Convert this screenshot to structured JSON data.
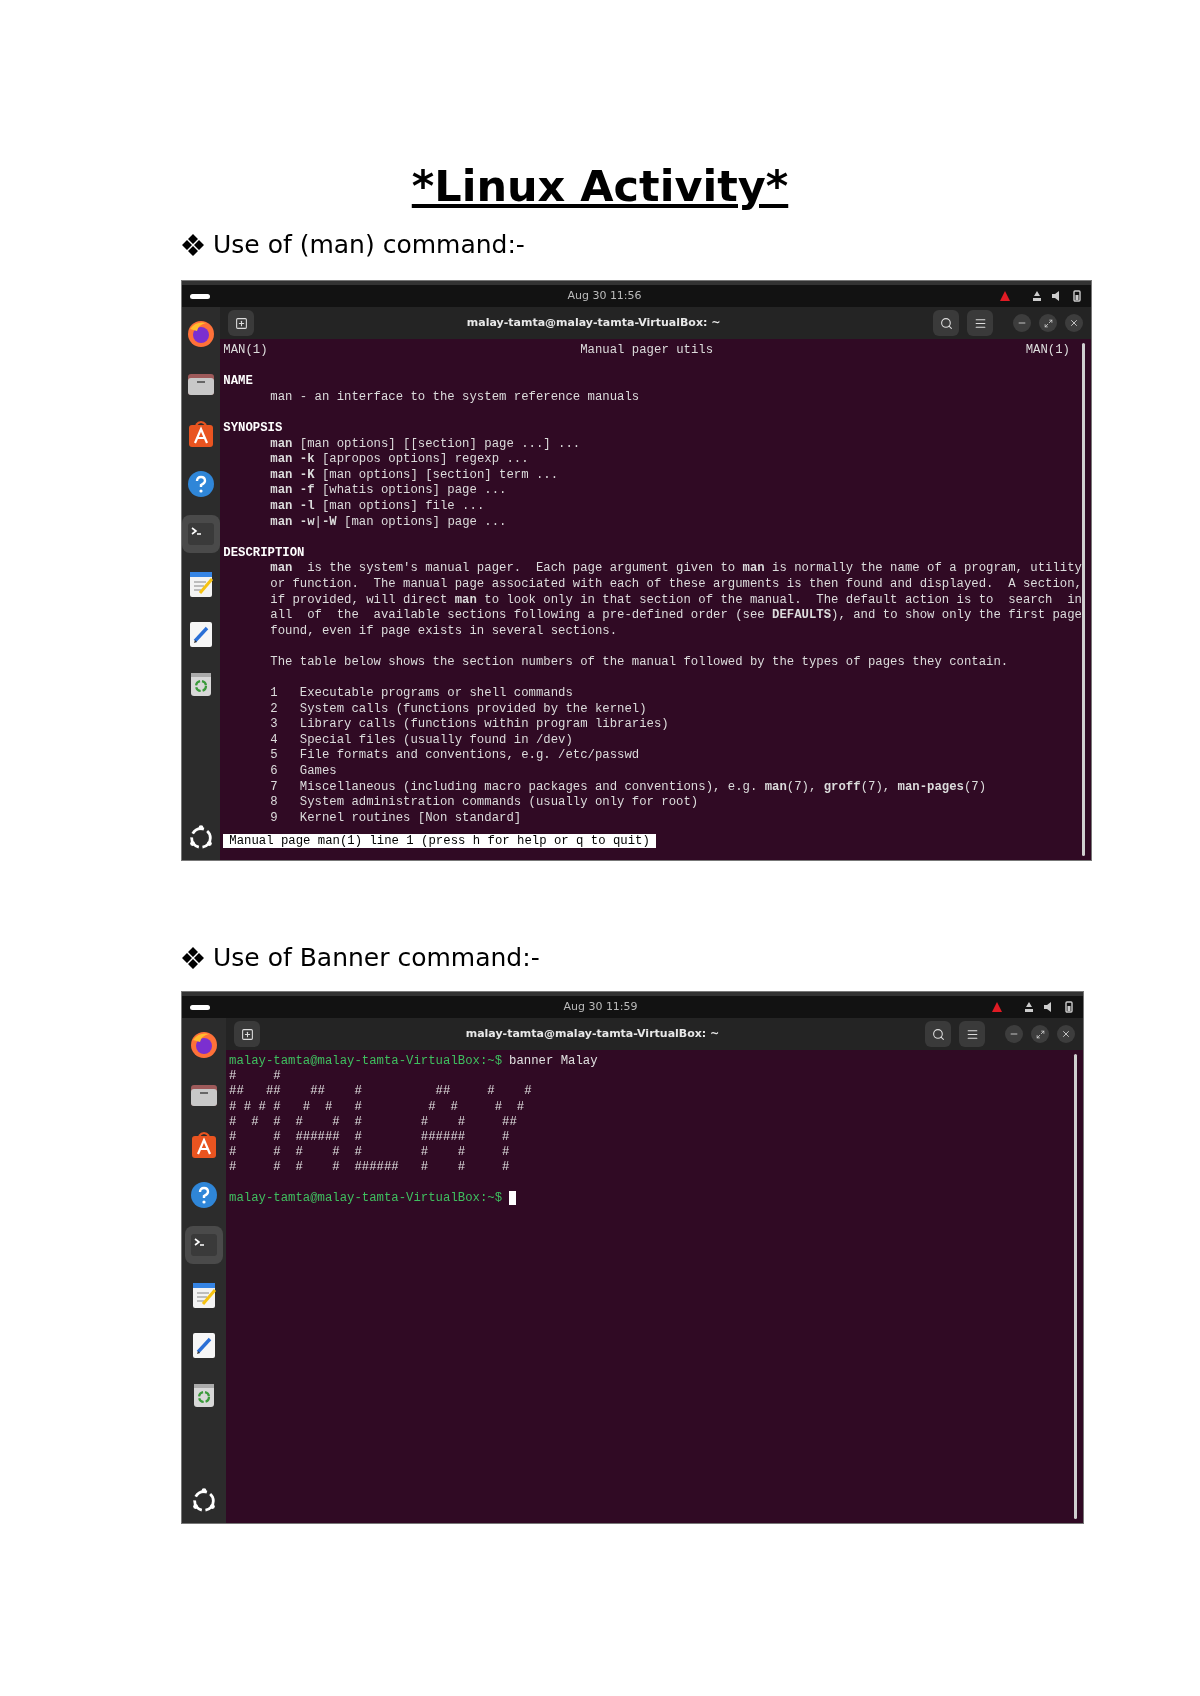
{
  "document": {
    "title": "*Linux Activity*"
  },
  "sections": [
    {
      "heading": "Use of (man) command:-",
      "screenshot": {
        "top_bar": {
          "clock": "Aug 30 11:56"
        },
        "window_title": "malay-tamta@malay-tamta-VirtualBox: ~",
        "dock": [
          {
            "kind": "browser",
            "selected": false
          },
          {
            "kind": "files",
            "selected": false
          },
          {
            "kind": "store",
            "selected": false
          },
          {
            "kind": "help",
            "selected": false
          },
          {
            "kind": "terminal",
            "selected": true
          },
          {
            "kind": "notes",
            "selected": false
          },
          {
            "kind": "editor",
            "selected": false
          },
          {
            "kind": "recycle",
            "selected": false
          }
        ],
        "terminal": {
          "kind": "manpage",
          "header": {
            "left": "MAN(1)",
            "center": "Manual pager utils",
            "right": "MAN(1)"
          },
          "blocks": [
            {
              "heading": "NAME",
              "paragraphs": [
                [
                  "man - an interface to the system reference manuals"
                ]
              ]
            },
            {
              "heading": "SYNOPSIS",
              "paragraphs": [
                [
                  "**man** [man options] [[section] page ...] ...",
                  "**man -k** [apropos options] regexp ...",
                  "**man -K** [man options] [section] term ...",
                  "**man -f** [whatis options] page ...",
                  "**man -l** [man options] file ...",
                  "**man -w**|**-W** [man options] page ..."
                ]
              ]
            },
            {
              "heading": "DESCRIPTION",
              "paragraphs": [
                [
                  "**man**  is the system's manual pager.  Each page argument given to **man** is normally the name of a program, utility",
                  "or function.  The manual page associated with each of these arguments is then found and displayed.  A section,",
                  "if provided, will direct **man** to look only in that section of the manual.  The default action is to  search  in",
                  "all  of  the  available sections following a pre-defined order (see **DEFAULTS**), and to show only the first page",
                  "found, even if page exists in several sections."
                ],
                [
                  "The table below shows the section numbers of the manual followed by the types of pages they contain."
                ],
                [
                  "1   Executable programs or shell commands",
                  "2   System calls (functions provided by the kernel)",
                  "3   Library calls (functions within program libraries)",
                  "4   Special files (usually found in /dev)",
                  "5   File formats and conventions, e.g. /etc/passwd",
                  "6   Games",
                  "7   Miscellaneous (including macro packages and conventions), e.g. **man**(7), **groff**(7), **man-pages**(7)",
                  "8   System administration commands (usually only for root)",
                  "9   Kernel routines [Non standard]"
                ]
              ]
            }
          ],
          "status_line": "Manual page man(1) line 1 (press h for help or q to quit)"
        }
      }
    },
    {
      "heading": "Use of Banner command:-",
      "screenshot": {
        "top_bar": {
          "clock": "Aug 30 11:59"
        },
        "window_title": "malay-tamta@malay-tamta-VirtualBox: ~",
        "dock": [
          {
            "kind": "browser",
            "selected": false
          },
          {
            "kind": "files",
            "selected": false
          },
          {
            "kind": "store",
            "selected": false
          },
          {
            "kind": "help",
            "selected": false
          },
          {
            "kind": "terminal",
            "selected": true
          },
          {
            "kind": "notes",
            "selected": false
          },
          {
            "kind": "editor",
            "selected": false
          },
          {
            "kind": "recycle",
            "selected": false
          }
        ],
        "terminal": {
          "kind": "shell",
          "lines": [
            {
              "kind": "command",
              "prompt": "malay-tamta@malay-tamta-VirtualBox:~$",
              "command": "banner Malay"
            },
            {
              "kind": "output",
              "text": "#     #"
            },
            {
              "kind": "output",
              "text": "##   ##    ##    #          ##     #    #"
            },
            {
              "kind": "output",
              "text": "# # # #   #  #   #         #  #     #  #"
            },
            {
              "kind": "output",
              "text": "#  #  #  #    #  #        #    #     ##"
            },
            {
              "kind": "output",
              "text": "#     #  ######  #        ######     #"
            },
            {
              "kind": "output",
              "text": "#     #  #    #  #        #    #     #"
            },
            {
              "kind": "output",
              "text": "#     #  #    #  ######   #    #     #"
            },
            {
              "kind": "blank"
            },
            {
              "kind": "cursor",
              "prompt": "malay-tamta@malay-tamta-VirtualBox:~$"
            }
          ]
        }
      }
    }
  ]
}
